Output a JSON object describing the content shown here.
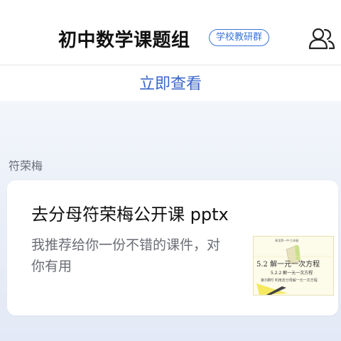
{
  "header": {
    "title": "初中数学课题组",
    "badge": "学校教研群",
    "contacts_icon": "contacts-icon"
  },
  "banner": {
    "view_link": "立即查看"
  },
  "message": {
    "sender": "符荣梅",
    "card": {
      "title": "去分母符荣梅公开课 pptx",
      "description": "我推荐给你一份不错的课件，对你有用",
      "thumbnail": {
        "top_text": "青龙第一中·九年级",
        "heading": "5.2  解一元一次方程",
        "subheading": "5.2.2  解一元一次方程",
        "subtitle": "第3课时  利用去分母解一元一次方程"
      }
    }
  },
  "colors": {
    "accent": "#3a67c8",
    "badge": "#3b74d6",
    "background_chat": "#e9eef7"
  }
}
